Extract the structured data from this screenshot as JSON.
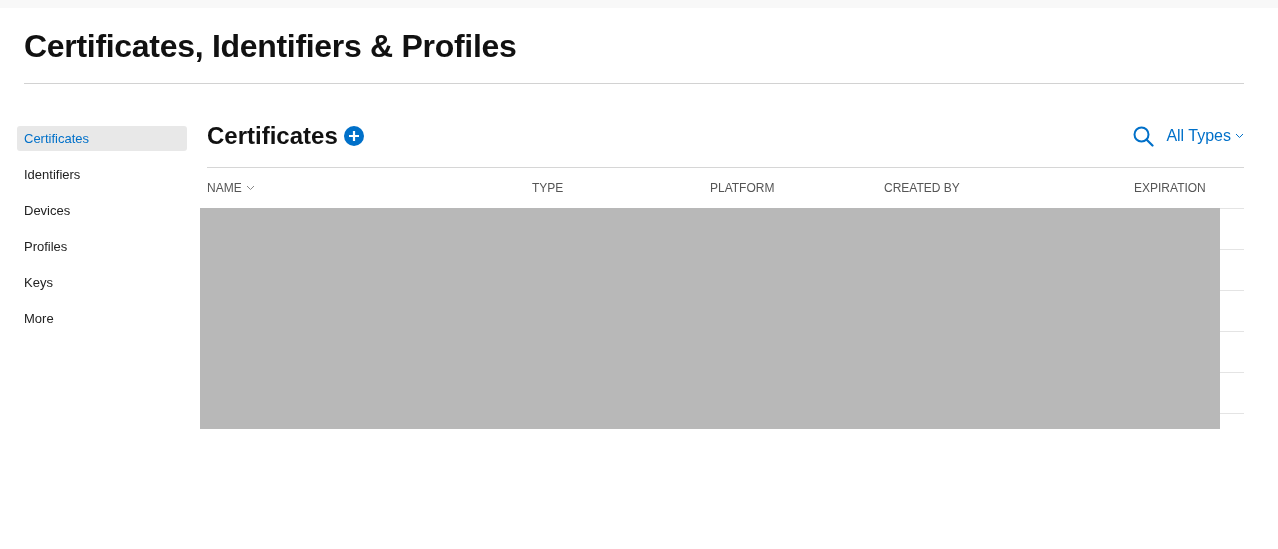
{
  "page": {
    "title": "Certificates, Identifiers & Profiles"
  },
  "sidebar": {
    "items": [
      {
        "label": "Certificates",
        "selected": true
      },
      {
        "label": "Identifiers",
        "selected": false
      },
      {
        "label": "Devices",
        "selected": false
      },
      {
        "label": "Profiles",
        "selected": false
      },
      {
        "label": "Keys",
        "selected": false
      },
      {
        "label": "More",
        "selected": false
      }
    ]
  },
  "section": {
    "title": "Certificates",
    "filter": "All Types"
  },
  "table": {
    "columns": [
      {
        "label": "NAME",
        "sorted": true
      },
      {
        "label": "TYPE",
        "sorted": false
      },
      {
        "label": "PLATFORM",
        "sorted": false
      },
      {
        "label": "CREATED BY",
        "sorted": false
      },
      {
        "label": "EXPIRATION",
        "sorted": false
      }
    ]
  }
}
